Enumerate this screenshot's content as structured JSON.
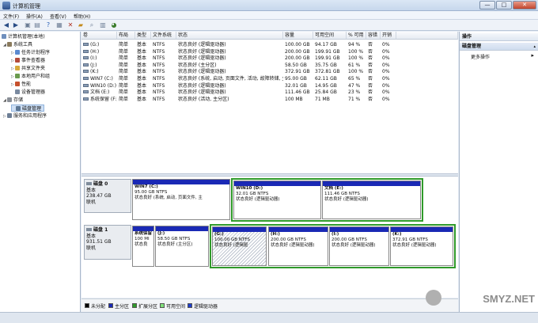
{
  "window": {
    "title": "计算机管理",
    "min": "—",
    "max": "□",
    "close": "✕"
  },
  "menu": [
    "文件(F)",
    "操作(A)",
    "查看(V)",
    "帮助(H)"
  ],
  "toolbar_icons": [
    "back-icon",
    "forward-icon",
    "up-icon",
    "show-hide-tree-icon",
    "help-icon",
    "properties-icon",
    "delete-icon",
    "folder-icon",
    "search-icon",
    "lock-icon",
    "pie-chart-icon"
  ],
  "tree": [
    {
      "label": "计算机管理(本地)",
      "level": 0,
      "arrow": "",
      "selected": false
    },
    {
      "label": "系统工具",
      "level": 1,
      "arrow": "◢",
      "selected": false
    },
    {
      "label": "任务计划程序",
      "level": 2,
      "arrow": "▷",
      "selected": false
    },
    {
      "label": "事件查看器",
      "level": 2,
      "arrow": "▷",
      "selected": false
    },
    {
      "label": "共享文件夹",
      "level": 2,
      "arrow": "▷",
      "selected": false
    },
    {
      "label": "本地用户和组",
      "level": 2,
      "arrow": "▷",
      "selected": false
    },
    {
      "label": "性能",
      "level": 2,
      "arrow": "▷",
      "selected": false
    },
    {
      "label": "设备管理器",
      "level": 2,
      "arrow": "",
      "selected": false
    },
    {
      "label": "存储",
      "level": 1,
      "arrow": "◢",
      "selected": false
    },
    {
      "label": "磁盘管理",
      "level": 2,
      "arrow": "",
      "selected": true
    },
    {
      "label": "服务和应用程序",
      "level": 1,
      "arrow": "▷",
      "selected": false
    }
  ],
  "volume_table": {
    "headers": [
      "卷",
      "布局",
      "类型",
      "文件系统",
      "状态",
      "容量",
      "可用空间",
      "% 可用",
      "容错",
      "开销"
    ],
    "rows": [
      [
        "(G:)",
        "简单",
        "基本",
        "NTFS",
        "状态良好 (逻辑驱动器)",
        "100.00 GB",
        "94.17 GB",
        "94 %",
        "否",
        "0%"
      ],
      [
        "(H:)",
        "简单",
        "基本",
        "NTFS",
        "状态良好 (逻辑驱动器)",
        "200.00 GB",
        "199.91 GB",
        "100 %",
        "否",
        "0%"
      ],
      [
        "(I:)",
        "简单",
        "基本",
        "NTFS",
        "状态良好 (逻辑驱动器)",
        "200.00 GB",
        "199.91 GB",
        "100 %",
        "否",
        "0%"
      ],
      [
        "(J:)",
        "简单",
        "基本",
        "NTFS",
        "状态良好 (主分区)",
        "58.50 GB",
        "35.75 GB",
        "61 %",
        "否",
        "0%"
      ],
      [
        "(K:)",
        "简单",
        "基本",
        "NTFS",
        "状态良好 (逻辑驱动器)",
        "372.91 GB",
        "372.81 GB",
        "100 %",
        "否",
        "0%"
      ],
      [
        "WIN7 (C:)",
        "简单",
        "基本",
        "NTFS",
        "状态良好 (系统, 启动, 页面文件, 活动, 故障转储, 主分区)",
        "95.00 GB",
        "62.11 GB",
        "65 %",
        "否",
        "0%"
      ],
      [
        "WIN10 (D:)",
        "简单",
        "基本",
        "NTFS",
        "状态良好 (逻辑驱动器)",
        "32.01 GB",
        "14.95 GB",
        "47 %",
        "否",
        "0%"
      ],
      [
        "文档 (E:)",
        "简单",
        "基本",
        "NTFS",
        "状态良好 (逻辑驱动器)",
        "111.46 GB",
        "25.84 GB",
        "23 %",
        "否",
        "0%"
      ],
      [
        "系统保留 (F:)",
        "简单",
        "基本",
        "NTFS",
        "状态良好 (活动, 主分区)",
        "100 MB",
        "71 MB",
        "71 %",
        "否",
        "0%"
      ]
    ]
  },
  "disks": [
    {
      "name": "磁盘 0",
      "type": "基本",
      "size": "238.47 GB",
      "status": "联机",
      "partitions": [
        {
          "name": "WIN7  (C:)",
          "size": "95.00 GB NTFS",
          "status": "状态良好 (系统, 启动, 页面文件, 主",
          "bar": "primary",
          "extended": false,
          "hatched": false
        },
        {
          "name": "WIN10  (D:)",
          "size": "32.01 GB NTFS",
          "status": "状态良好 (逻辑驱动器)",
          "bar": "logical",
          "extended": true,
          "hatched": false
        },
        {
          "name": "文档  (E:)",
          "size": "111.46 GB NTFS",
          "status": "状态良好 (逻辑驱动器)",
          "bar": "logical",
          "extended": true,
          "hatched": false
        }
      ]
    },
    {
      "name": "磁盘 1",
      "type": "基本",
      "size": "931.51 GB",
      "status": "联机",
      "partitions": [
        {
          "name": "系统保留",
          "size": "100 MI",
          "status": "状态良",
          "bar": "primary",
          "extended": false,
          "hatched": false
        },
        {
          "name": "(J:)",
          "size": "58.50 GB NTFS",
          "status": "状态良好 (主分区)",
          "bar": "primary",
          "extended": false,
          "hatched": false
        },
        {
          "name": "(G:)",
          "size": "100.00 GB NTFS",
          "status": "状态良好 (逻辑驱",
          "bar": "logical",
          "extended": true,
          "hatched": true
        },
        {
          "name": "(H:)",
          "size": "200.00 GB NTFS",
          "status": "状态良好 (逻辑驱动器)",
          "bar": "logical",
          "extended": true,
          "hatched": false
        },
        {
          "name": "(I:)",
          "size": "200.00 GB NTFS",
          "status": "状态良好 (逻辑驱动器)",
          "bar": "logical",
          "extended": true,
          "hatched": false
        },
        {
          "name": "(K:)",
          "size": "372.91 GB NTFS",
          "status": "状态良好 (逻辑驱动器)",
          "bar": "logical",
          "extended": true,
          "hatched": false
        }
      ]
    }
  ],
  "legend": [
    {
      "label": "未分配",
      "color": "#000000"
    },
    {
      "label": "主分区",
      "color": "#1a29b5"
    },
    {
      "label": "扩展分区",
      "color": "#2f9a2a"
    },
    {
      "label": "可用空间",
      "color": "#7fe07a"
    },
    {
      "label": "逻辑驱动器",
      "color": "#1f3fcc"
    }
  ],
  "actions": {
    "header": "操作",
    "section": "磁盘管理",
    "more": "更多操作",
    "more_arrow": "▸"
  },
  "watermark": "SMYZ.NET"
}
